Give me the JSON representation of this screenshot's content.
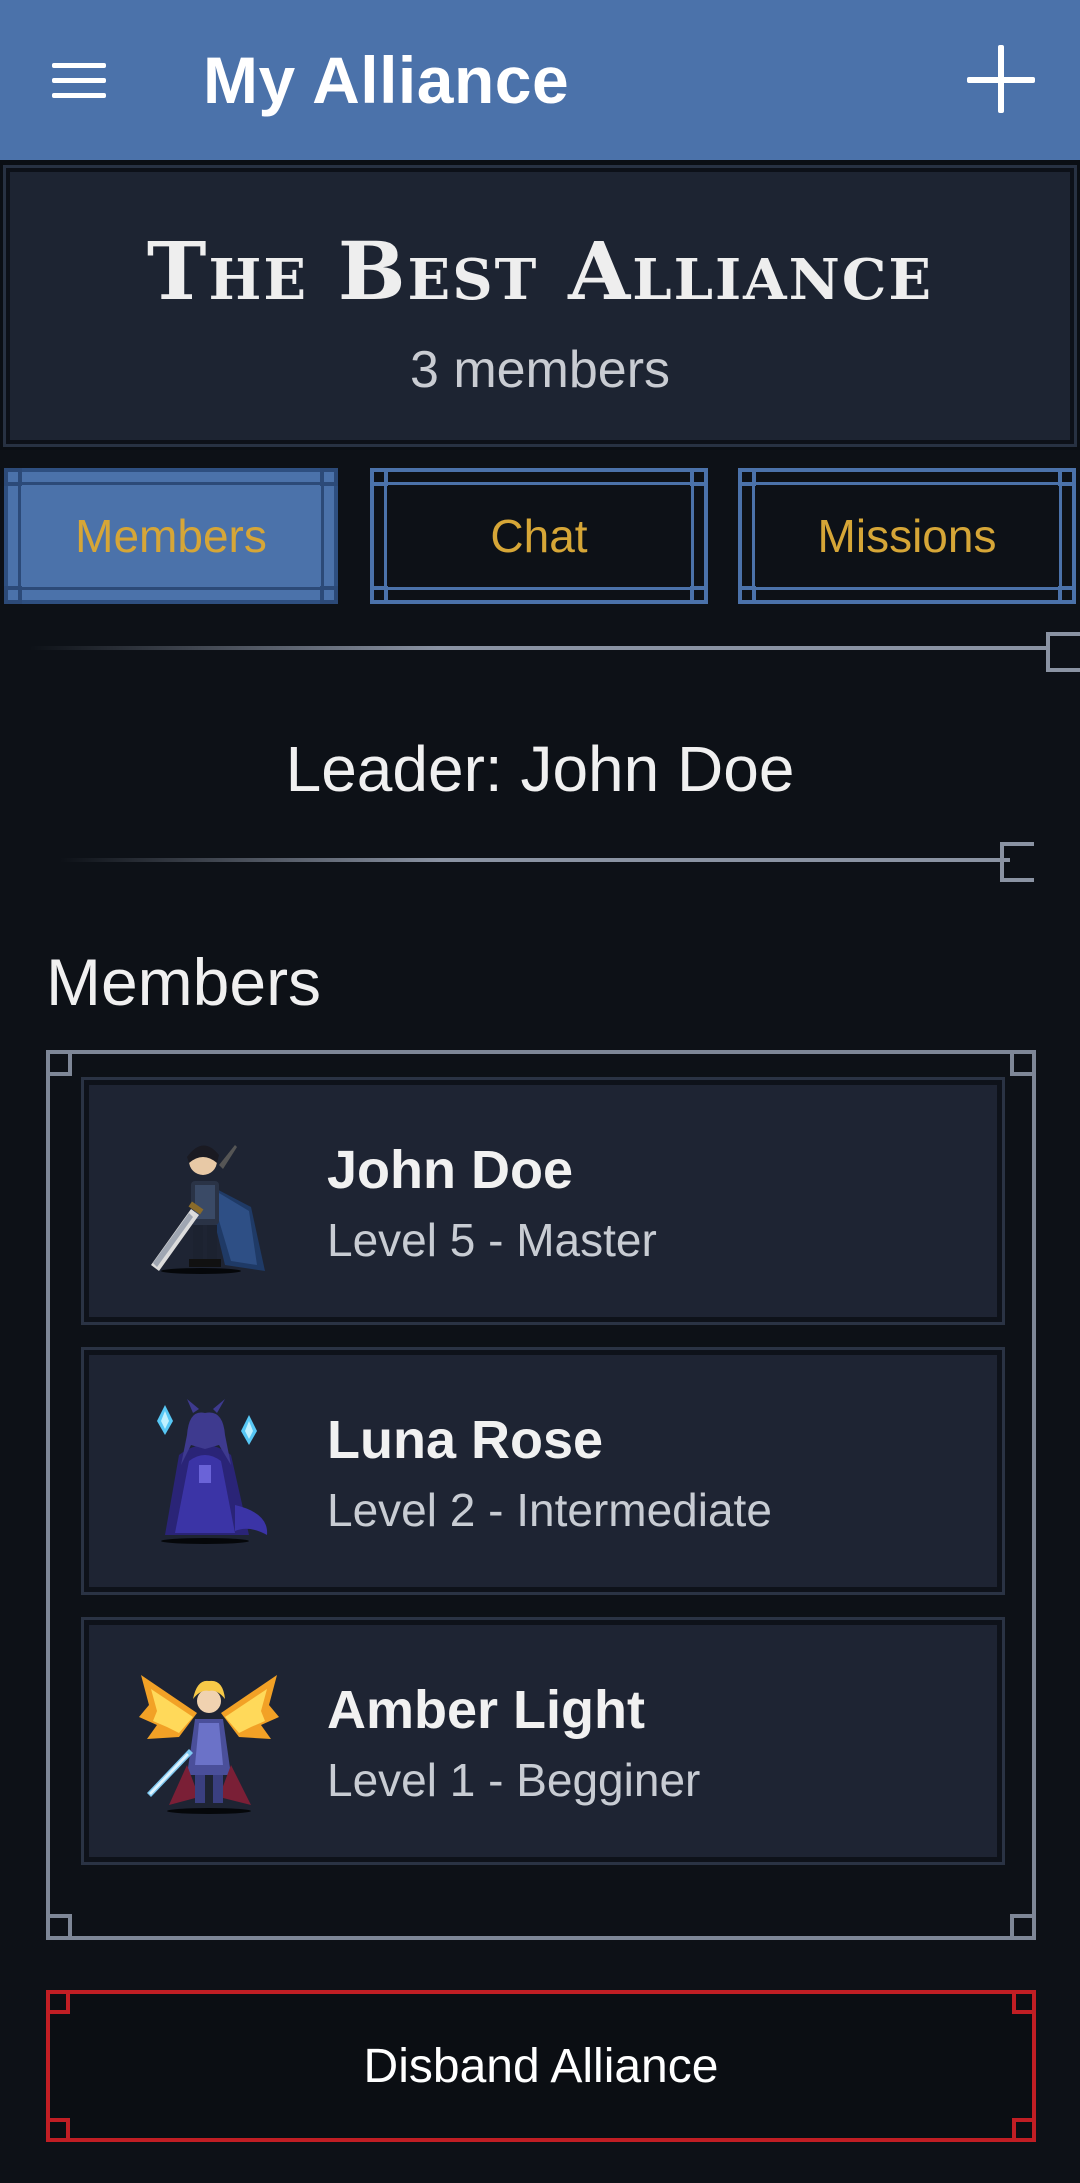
{
  "app_bar": {
    "title": "My Alliance",
    "menu_icon": "hamburger-menu-icon",
    "add_icon": "plus-icon",
    "color": "#4b72aa"
  },
  "banner": {
    "alliance_name": "The Best Alliance",
    "member_count": "3 members"
  },
  "tabs": [
    {
      "label": "Members",
      "active": true
    },
    {
      "label": "Chat",
      "active": false
    },
    {
      "label": "Missions",
      "active": false
    }
  ],
  "leader": {
    "text": "Leader: John Doe"
  },
  "members": {
    "heading": "Members",
    "list": [
      {
        "name": "John Doe",
        "level": "Level 5 - Master",
        "avatar": "dark-knight-avatar"
      },
      {
        "name": "Luna Rose",
        "level": "Level 2 - Intermediate",
        "avatar": "blue-sorceress-avatar"
      },
      {
        "name": "Amber Light",
        "level": "Level 1 - Begginer",
        "avatar": "winged-warrior-avatar"
      }
    ]
  },
  "actions": {
    "disband_label": "Disband Alliance",
    "disband_color": "#c11e24"
  },
  "colors": {
    "background": "#0d1117",
    "tab_text": "#d6a637",
    "card": "#1e2433"
  }
}
